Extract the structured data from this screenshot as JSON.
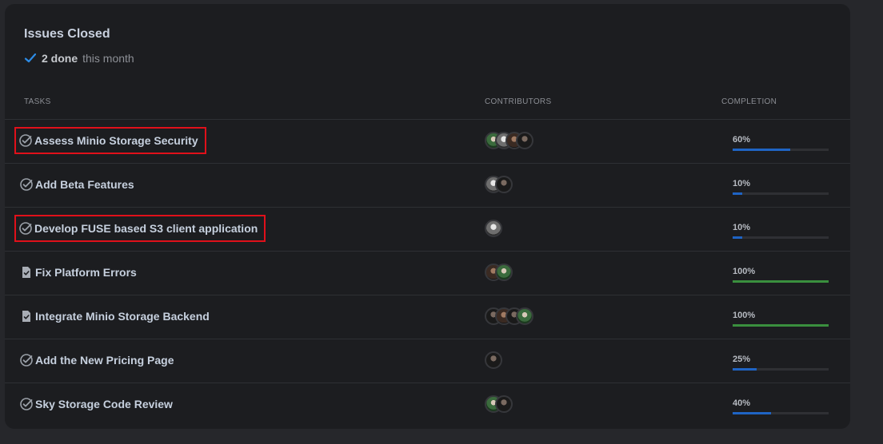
{
  "card": {
    "title": "Issues Closed",
    "done_count": "2 done",
    "done_suffix": "this month"
  },
  "columns": {
    "tasks": "TASKS",
    "contributors": "CONTRIBUTORS",
    "completion": "COMPLETION"
  },
  "colors": {
    "progress_blue": "#1f64c4",
    "progress_green": "#3a8f3e",
    "highlight_red": "#e0101a",
    "check_blue": "#2d8ce6"
  },
  "rows": [
    {
      "name": "Assess Minio Storage Security",
      "icon": "check-circle-icon",
      "contributors": [
        "green",
        "grey",
        "brown",
        "black"
      ],
      "completion_label": "60%",
      "completion": 0.6,
      "status": "in-progress",
      "highlighted": true
    },
    {
      "name": "Add Beta Features",
      "icon": "check-circle-icon",
      "contributors": [
        "grey",
        "black"
      ],
      "completion_label": "10%",
      "completion": 0.1,
      "status": "in-progress",
      "highlighted": false
    },
    {
      "name": "Develop FUSE based S3 client application",
      "icon": "check-circle-icon",
      "contributors": [
        "grey"
      ],
      "completion_label": "10%",
      "completion": 0.1,
      "status": "in-progress",
      "highlighted": true
    },
    {
      "name": "Fix Platform Errors",
      "icon": "document-check-icon",
      "contributors": [
        "brown",
        "green"
      ],
      "completion_label": "100%",
      "completion": 1.0,
      "status": "done",
      "highlighted": false
    },
    {
      "name": "Integrate Minio Storage Backend",
      "icon": "document-check-icon",
      "contributors": [
        "black",
        "brown",
        "black",
        "green"
      ],
      "completion_label": "100%",
      "completion": 1.0,
      "status": "done",
      "highlighted": false
    },
    {
      "name": "Add the New Pricing Page",
      "icon": "check-circle-icon",
      "contributors": [
        "black"
      ],
      "completion_label": "25%",
      "completion": 0.25,
      "status": "in-progress",
      "highlighted": false
    },
    {
      "name": "Sky Storage Code Review",
      "icon": "check-circle-icon",
      "contributors": [
        "green",
        "black"
      ],
      "completion_label": "40%",
      "completion": 0.4,
      "status": "in-progress",
      "highlighted": false
    }
  ]
}
